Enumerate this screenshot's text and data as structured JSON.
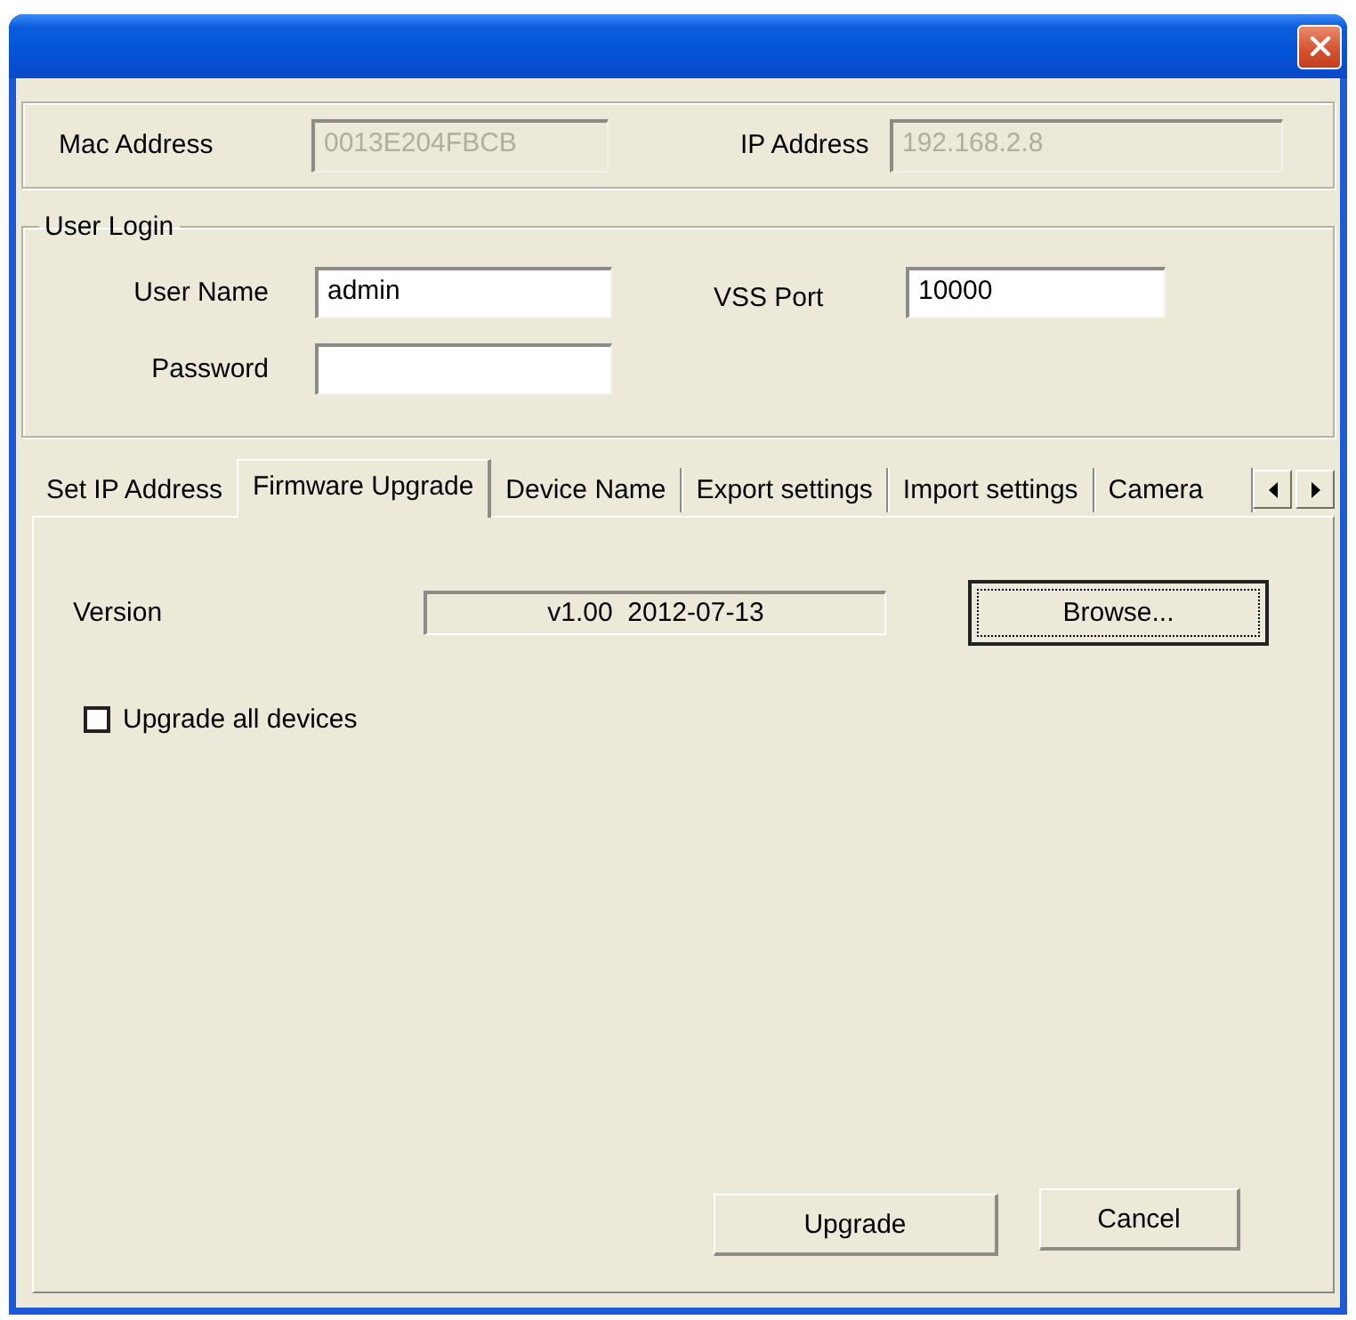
{
  "device_info": {
    "fields": [
      {
        "label": "Mac Address",
        "value": "0013E204FBCB",
        "disabled": true
      },
      {
        "label": "IP Address",
        "value": "192.168.2.8",
        "disabled": true
      }
    ]
  },
  "user_login": {
    "title": "User Login",
    "credentials": [
      {
        "label": "User Name",
        "value": "admin"
      },
      {
        "label": "Password"
      }
    ],
    "port": {
      "label": "VSS Port",
      "value": "10000"
    }
  },
  "tabs": [
    {
      "label": "Set IP Address",
      "selected": false
    },
    {
      "label": "Firmware Upgrade",
      "selected": true
    },
    {
      "label": "Device Name",
      "selected": false
    },
    {
      "label": "Export settings",
      "selected": false
    },
    {
      "label": "Import settings",
      "selected": false
    },
    {
      "label": "Camera",
      "selected": false
    }
  ],
  "firmware_panel": {
    "version": {
      "label": "Version",
      "value": "v1.00  2012-07-13"
    },
    "browse_button": {
      "label": "Browse...",
      "focused": true
    },
    "upgrade_all": {
      "label": "Upgrade all devices",
      "checked": false
    }
  },
  "buttons": [
    "Upgrade",
    "Cancel"
  ]
}
